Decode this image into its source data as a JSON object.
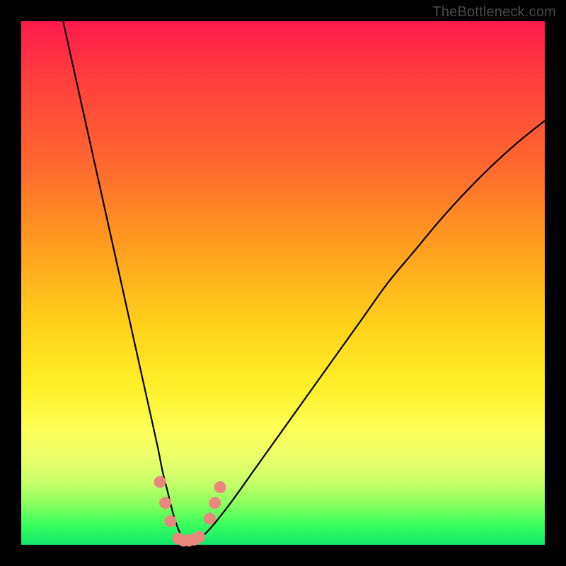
{
  "watermark": "TheBottleneck.com",
  "chart_data": {
    "type": "line",
    "title": "",
    "xlabel": "",
    "ylabel": "",
    "xlim": [
      0,
      100
    ],
    "ylim": [
      0,
      100
    ],
    "series": [
      {
        "name": "bottleneck-curve",
        "x": [
          8,
          10,
          12,
          14,
          16,
          18,
          20,
          22,
          24,
          26,
          27,
          28,
          29,
          30,
          31,
          32,
          33,
          34,
          36,
          40,
          45,
          50,
          55,
          60,
          65,
          70,
          75,
          80,
          85,
          90,
          95,
          100
        ],
        "values": [
          100,
          91,
          82,
          73,
          64,
          55,
          46,
          37,
          28,
          19,
          14,
          10,
          6,
          3,
          1.2,
          0.6,
          0.7,
          1.2,
          3,
          8,
          15,
          22,
          29,
          36,
          43,
          50,
          56,
          62,
          67.5,
          72.5,
          77,
          81
        ]
      }
    ],
    "markers": {
      "name": "highlight-dots",
      "color": "#e9877f",
      "points_xy": [
        [
          26.5,
          12
        ],
        [
          27.5,
          8
        ],
        [
          28.5,
          4.5
        ],
        [
          30,
          1.2
        ],
        [
          31,
          0.8
        ],
        [
          32,
          0.8
        ],
        [
          33,
          1.0
        ],
        [
          34,
          1.5
        ],
        [
          36,
          5
        ],
        [
          37,
          8
        ],
        [
          38,
          11
        ]
      ]
    }
  },
  "colors": {
    "curve": "#000000",
    "marker": "#e9877f",
    "frame": "#000000"
  }
}
